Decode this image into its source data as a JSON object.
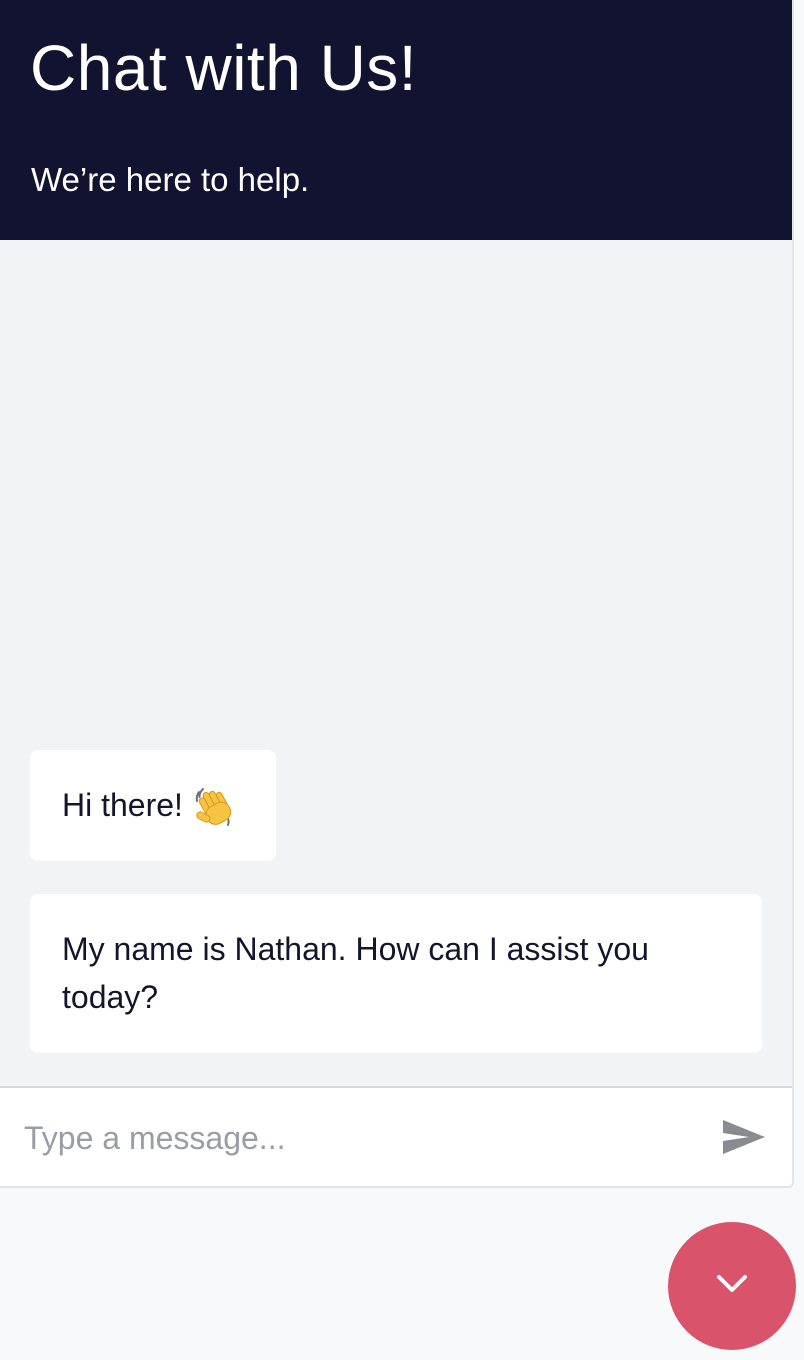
{
  "header": {
    "title": "Chat with Us!",
    "subtitle": "We’re here to help."
  },
  "messages": [
    {
      "text": "Hi there!",
      "emoji": "waving-hand-icon"
    },
    {
      "text": "My name is Nathan. How can I assist you today?"
    }
  ],
  "composer": {
    "placeholder": "Type a message...",
    "send_icon": "send-icon"
  },
  "launcher": {
    "icon": "chevron-down-icon"
  },
  "colors": {
    "header_bg": "#121330",
    "chat_bg": "#f2f3f7",
    "bubble_bg": "#ffffff",
    "text": "#14142b",
    "placeholder": "#9a9ca6",
    "send_icon": "#8a8b90",
    "launcher_bg": "#d9536b"
  }
}
